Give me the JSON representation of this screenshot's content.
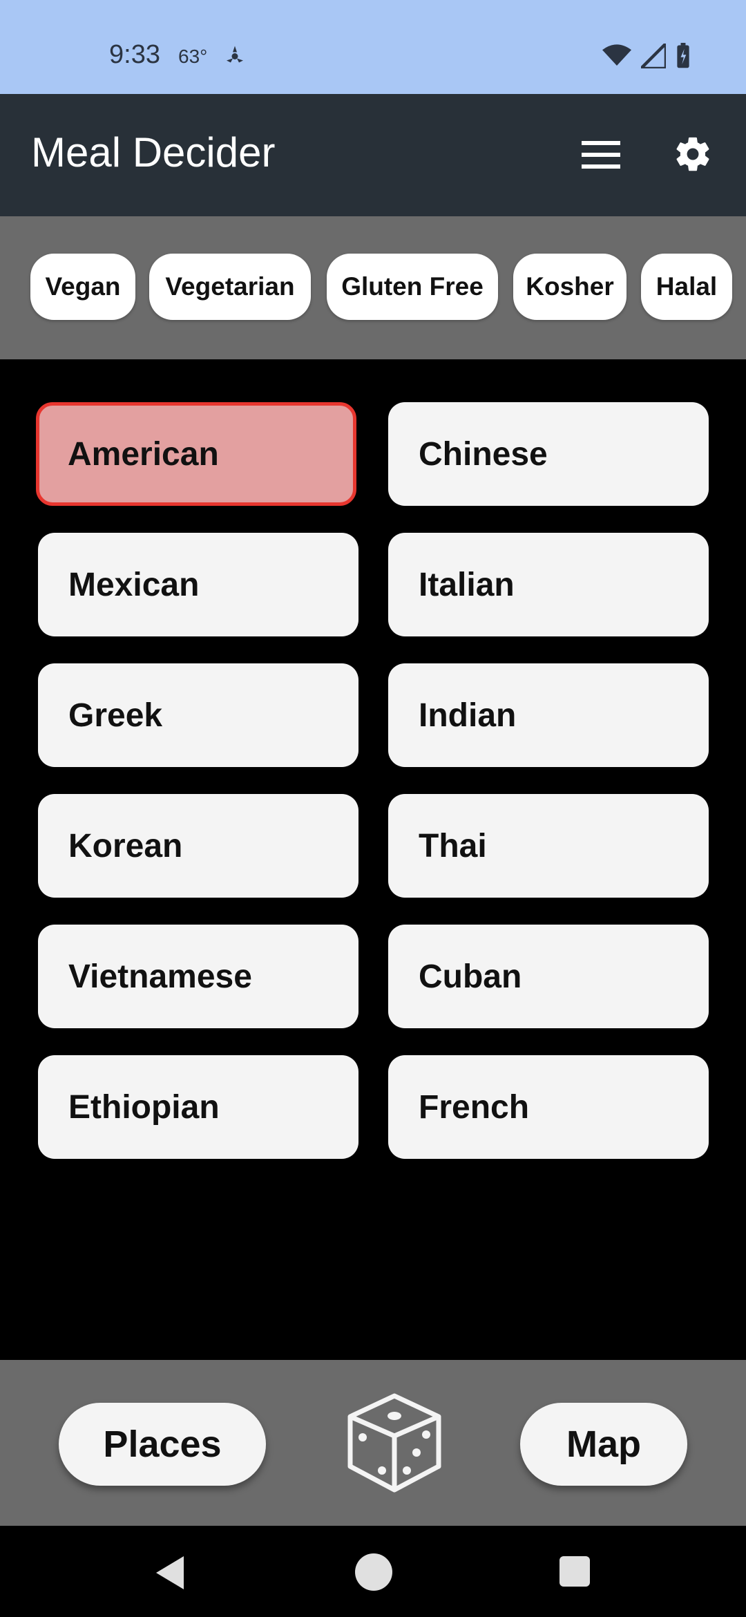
{
  "status_bar": {
    "time": "9:33",
    "temperature": "63°",
    "weather_icon": "weather-fan-icon",
    "right_icons": [
      "wifi-icon",
      "cell-signal-icon",
      "battery-icon"
    ]
  },
  "app_bar": {
    "title": "Meal Decider",
    "menu_icon": "hamburger-menu-icon",
    "settings_icon": "gear-icon"
  },
  "filters": {
    "chips": [
      "Vegan",
      "Vegetarian",
      "Gluten Free",
      "Kosher",
      "Halal"
    ]
  },
  "cuisines": {
    "items": [
      {
        "label": "American",
        "selected": true
      },
      {
        "label": "Chinese",
        "selected": false
      },
      {
        "label": "Mexican",
        "selected": false
      },
      {
        "label": "Italian",
        "selected": false
      },
      {
        "label": "Greek",
        "selected": false
      },
      {
        "label": "Indian",
        "selected": false
      },
      {
        "label": "Korean",
        "selected": false
      },
      {
        "label": "Thai",
        "selected": false
      },
      {
        "label": "Vietnamese",
        "selected": false
      },
      {
        "label": "Cuban",
        "selected": false
      },
      {
        "label": "Ethiopian",
        "selected": false
      },
      {
        "label": "French",
        "selected": false
      }
    ]
  },
  "bottom_bar": {
    "places_label": "Places",
    "map_label": "Map",
    "randomize_icon": "dice-icon"
  },
  "nav_bar": {
    "icons": [
      "back-icon",
      "home-icon",
      "recents-icon"
    ]
  },
  "colors": {
    "status_bar": "#a9c7f5",
    "app_bar": "#283038",
    "strip_gray": "#6b6b6b",
    "selected_fill": "#e3a0a0",
    "selected_border": "#e8362f",
    "card_fill": "#f4f4f4"
  }
}
